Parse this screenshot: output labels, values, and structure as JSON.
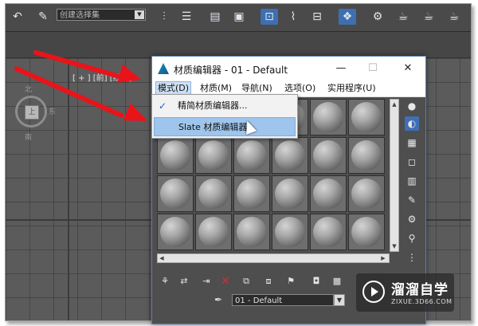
{
  "toolbar": {
    "selection_set_text": "创建选择集",
    "icons": [
      "undo-icon",
      "edit-named-sel-icon",
      "align-icon",
      "layer-icon",
      "graph-editor-icon",
      "schematic-icon",
      "material-editor-icon",
      "render-setup-icon",
      "render-frame-icon",
      "render-icon",
      "render-env-icon",
      "teapot-icon"
    ]
  },
  "viewport": {
    "label": "[ + ] [前] [线框]",
    "viewcube": {
      "face": "上",
      "north": "北",
      "south": "南",
      "east": "东"
    }
  },
  "dialog": {
    "title": "材质编辑器 - 01 - Default",
    "minimize": "—",
    "maximize": "☐",
    "close": "✕",
    "menus": [
      "模式(D)",
      "材质(M)",
      "导航(N)",
      "选项(O)",
      "实用程序(U)"
    ],
    "active_menu_index": 0,
    "material_name": "01 - Default",
    "sample_slots": 24
  },
  "mode_menu": {
    "items": [
      {
        "label": "精简材质编辑器...",
        "checked": true
      },
      {
        "label": "Slate 材质编辑器...",
        "checked": false,
        "highlighted": true
      }
    ]
  },
  "watermark": {
    "title": "溜溜自学",
    "url": "ZIXUE.3D66.COM"
  },
  "colors": {
    "annotation_arrow": "#e8141a",
    "menu_highlight": "#9fc5ec",
    "viewport_bg": "#5b5b5b"
  }
}
